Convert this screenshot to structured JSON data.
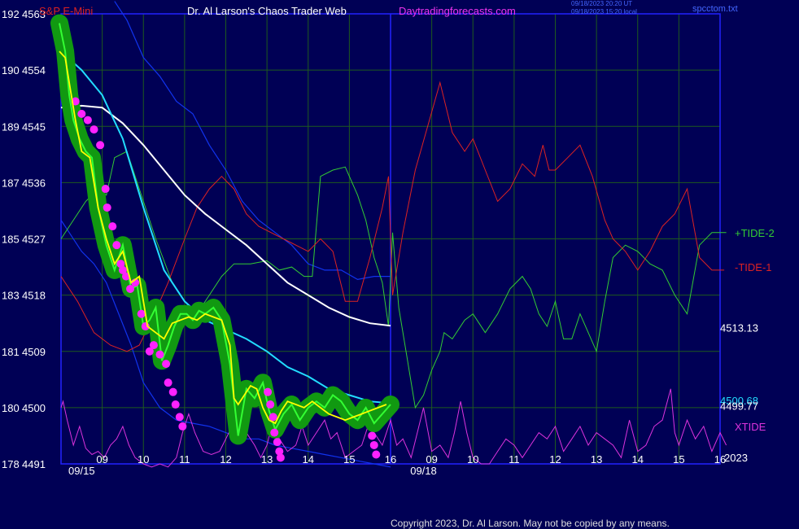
{
  "header": {
    "symbol": "S&P E-Mini",
    "title": "Dr. Al Larson's Chaos Trader Web",
    "site": "Daytradingforecasts.com",
    "timestamp_utc": "09/18/2023 20:20 UT",
    "timestamp_local": "09/18/2023 15:20 local",
    "filename": "spcctom.txt"
  },
  "footer": {
    "copyright": "Copyright 2023, Dr. Al Larson. May not be copied by any means."
  },
  "colors": {
    "background": "#000055",
    "grid": "#1e5a1e",
    "frame": "#2222ff",
    "price": "#33ff33",
    "glow": "#119911",
    "dots": "#ff22ff",
    "ma_fast": "#ffff00",
    "ma_mid": "#22ddff",
    "ma_slow": "#ffffff",
    "band": "#1133ee",
    "tide2": "#33cc33",
    "tide1": "#dd2222",
    "xtide": "#dd33dd"
  },
  "chart_data": {
    "type": "line",
    "ylim": [
      4491,
      4563
    ],
    "y_ticks": [
      {
        "left": "192",
        "right": "4563",
        "value": 4563
      },
      {
        "left": "190",
        "right": "4554",
        "value": 4554
      },
      {
        "left": "189",
        "right": "4545",
        "value": 4545
      },
      {
        "left": "187",
        "right": "4536",
        "value": 4536
      },
      {
        "left": "185",
        "right": "4527",
        "value": 4527
      },
      {
        "left": "183",
        "right": "4518",
        "value": 4518
      },
      {
        "left": "181",
        "right": "4509",
        "value": 4509
      },
      {
        "left": "180",
        "right": "4500",
        "value": 4500
      },
      {
        "left": "178",
        "right": "4491",
        "value": 4491
      }
    ],
    "x_hours": [
      {
        "label": "09",
        "t": 1
      },
      {
        "label": "10",
        "t": 2
      },
      {
        "label": "11",
        "t": 3
      },
      {
        "label": "12",
        "t": 4
      },
      {
        "label": "13",
        "t": 5
      },
      {
        "label": "14",
        "t": 6
      },
      {
        "label": "15",
        "t": 7
      },
      {
        "label": "16",
        "t": 8
      },
      {
        "label": "09",
        "t": 9
      },
      {
        "label": "10",
        "t": 10
      },
      {
        "label": "11",
        "t": 11
      },
      {
        "label": "12",
        "t": 12
      },
      {
        "label": "13",
        "t": 13
      },
      {
        "label": "14",
        "t": 14
      },
      {
        "label": "15",
        "t": 15
      },
      {
        "label": "16",
        "t": 16
      }
    ],
    "x_dates": [
      {
        "label": "09/15",
        "t": 0.5
      },
      {
        "label": "09/18",
        "t": 8.8
      }
    ],
    "year_label": "2023",
    "tide_labels": [
      {
        "name": "+TIDE-2",
        "value": 4528,
        "color_key": "tide2"
      },
      {
        "name": "-TIDE-1",
        "value": 4522.5,
        "color_key": "tide1"
      },
      {
        "name": "XTIDE",
        "value": 4497,
        "color_key": "xtide"
      }
    ],
    "price_labels": [
      {
        "text": "4513.13",
        "value": 4512.7,
        "color_key": "ma_slow"
      },
      {
        "text": "4500.68",
        "value": 4501.0,
        "color_key": "ma_mid"
      },
      {
        "text": "4499.77",
        "value": 4500.2,
        "color_key": "ma_slow"
      }
    ],
    "series": [
      {
        "key": "price",
        "x": [
          -0.04,
          0.1,
          0.2,
          0.3,
          0.45,
          0.6,
          0.75,
          0.9,
          1.1,
          1.3,
          1.5,
          1.7,
          1.85,
          2.0,
          2.15,
          2.3,
          2.45,
          2.6,
          2.75,
          2.9,
          3.05,
          3.2,
          3.35,
          3.5,
          3.7,
          3.9,
          4.1,
          4.3,
          4.5,
          4.7,
          4.9,
          5.05,
          5.2,
          5.4,
          5.6,
          5.8,
          6.0,
          6.2,
          6.4,
          6.6,
          6.8,
          7.0,
          7.2,
          7.4,
          7.6,
          7.8,
          8.0
        ],
        "y": [
          4561.5,
          4557,
          4550,
          4546,
          4543,
          4541,
          4540,
          4532,
          4526,
          4522,
          4526,
          4519,
          4519.5,
          4513,
          4514,
          4516,
          4507.5,
          4510,
          4513,
          4515,
          4515,
          4514,
          4515.5,
          4515,
          4516,
          4514,
          4507,
          4495.5,
          4503,
          4501.5,
          4504,
          4499.5,
          4496.5,
          4499,
          4500.5,
          4498,
          4500,
          4501,
          4500,
          4502,
          4501,
          4499,
          4498,
          4500,
          4497.5,
          4499,
          4500.5
        ]
      },
      {
        "key": "ma_fast",
        "x": [
          -0.04,
          0.1,
          0.2,
          0.35,
          0.5,
          0.7,
          0.9,
          1.1,
          1.3,
          1.5,
          1.7,
          1.9,
          2.1,
          2.3,
          2.5,
          2.7,
          2.9,
          3.1,
          3.3,
          3.5,
          3.7,
          3.9,
          4.1,
          4.2,
          4.3,
          4.45,
          4.6,
          4.75,
          4.9,
          5.05,
          5.2,
          5.35,
          5.5,
          5.7,
          5.9,
          6.1,
          6.3,
          6.5,
          6.7,
          6.9,
          7.1,
          7.3,
          7.5,
          7.7,
          7.9
        ],
        "y": [
          4557,
          4556,
          4552,
          4546,
          4541,
          4540,
          4532,
          4527,
          4523,
          4525,
          4520,
          4521,
          4513,
          4512,
          4511,
          4513.5,
          4514,
          4514.5,
          4514,
          4515,
          4514.5,
          4514,
          4510,
          4501.5,
          4500.5,
          4502,
          4503.5,
          4503,
          4500,
          4498,
          4497.5,
          4499.5,
          4501,
          4500.5,
          4500,
          4501,
          4500,
          4499,
          4498.5,
          4498,
          4498.5,
          4499,
          4499.5,
          4500,
          4500.5
        ]
      },
      {
        "key": "ma_mid",
        "x": [
          0,
          0.5,
          1.0,
          1.5,
          2.0,
          2.5,
          3.0,
          3.5,
          4.0,
          4.5,
          5.0,
          5.5,
          6.0,
          6.5,
          7.0,
          7.5,
          8.0
        ],
        "y": [
          4557,
          4554,
          4550,
          4543,
          4532,
          4522,
          4517,
          4514,
          4512.5,
          4511,
          4509,
          4506.5,
          4505,
          4503,
          4502,
          4501,
          4500.7
        ]
      },
      {
        "key": "ma_slow",
        "x": [
          0,
          0.5,
          1.0,
          1.5,
          2.0,
          2.5,
          3.0,
          3.5,
          4.0,
          4.5,
          5.0,
          5.5,
          6.0,
          6.5,
          7.0,
          7.5,
          8.0
        ],
        "y": [
          4548,
          4548.3,
          4548,
          4545.5,
          4542,
          4538,
          4534,
          4531,
          4528.5,
          4526,
          4523,
          4520,
          4518,
          4516,
          4514.5,
          4513.5,
          4513.1
        ]
      },
      {
        "key": "band_hi",
        "x": [
          1.3,
          1.6,
          2.0,
          2.4,
          2.8,
          3.2,
          3.6,
          4.0,
          4.4,
          4.8,
          5.2,
          5.6,
          6.0,
          6.4,
          6.8,
          7.2,
          7.6,
          8.0
        ],
        "y": [
          4565,
          4562,
          4556,
          4553,
          4549,
          4547,
          4542,
          4538,
          4533,
          4530,
          4528,
          4526,
          4523,
          4522,
          4522,
          4520.5,
          4521,
          4521
        ]
      },
      {
        "key": "band_lo",
        "x": [
          0,
          0.2,
          0.5,
          0.8,
          1.1,
          1.4,
          1.7,
          2.0,
          2.4,
          2.8,
          3.2,
          3.6,
          4.0,
          4.4,
          4.8,
          5.2,
          5.6,
          6.0,
          6.4,
          6.8,
          7.2,
          7.6,
          8.0
        ],
        "y": [
          4530,
          4528,
          4525,
          4523,
          4520,
          4515,
          4510,
          4504,
          4500,
          4498,
          4497.5,
          4497,
          4496,
          4495,
          4495,
          4494,
          4493.5,
          4493,
          4492.5,
          4492,
          4491.5,
          4491,
          4490.5
        ]
      },
      {
        "key": "tide2",
        "x": [
          0,
          0.3,
          0.6,
          0.9,
          1.1,
          1.3,
          1.6,
          1.9,
          2.3,
          2.7,
          3.0,
          3.3,
          3.6,
          3.9,
          4.2,
          4.6,
          5.0,
          5.3,
          5.6,
          5.9,
          6.1,
          6.3,
          6.6,
          6.9,
          7.2,
          7.4,
          7.6,
          7.8,
          7.95,
          8.05,
          8.2,
          8.4,
          8.6,
          8.8,
          9.0,
          9.2,
          9.3,
          9.5,
          9.8,
          10.0,
          10.3,
          10.6,
          10.9,
          11.2,
          11.4,
          11.6,
          11.8,
          12.0,
          12.2,
          12.4,
          12.6,
          12.8,
          13.0,
          13.2,
          13.4,
          13.7,
          14.0,
          14.3,
          14.6,
          14.9,
          15.2,
          15.5,
          15.8,
          16.1,
          16.15
        ],
        "y": [
          4527,
          4530,
          4533,
          4535,
          4534,
          4540,
          4541,
          4535,
          4527,
          4520,
          4517,
          4515,
          4518,
          4521,
          4523,
          4523,
          4523.5,
          4522,
          4522.5,
          4521,
          4521,
          4537,
          4538,
          4538.5,
          4534,
          4530,
          4524,
          4520,
          4513,
          4528,
          4516,
          4508,
          4500,
          4502,
          4506,
          4509,
          4512,
          4511,
          4514,
          4515,
          4512,
          4515,
          4519,
          4521,
          4519,
          4515,
          4513,
          4517,
          4511,
          4511,
          4515,
          4512,
          4509,
          4517,
          4524,
          4526,
          4525,
          4523,
          4522,
          4518,
          4515,
          4526,
          4528,
          4528,
          4528
        ]
      },
      {
        "key": "tide1",
        "x": [
          0,
          0.4,
          0.8,
          1.2,
          1.6,
          1.9,
          2.2,
          2.6,
          3.0,
          3.3,
          3.6,
          3.9,
          4.2,
          4.5,
          4.8,
          5.1,
          5.4,
          5.7,
          6.0,
          6.3,
          6.6,
          6.9,
          7.2,
          7.5,
          7.8,
          7.95,
          8.05,
          8.3,
          8.6,
          8.9,
          9.2,
          9.5,
          9.8,
          10.0,
          10.3,
          10.6,
          10.9,
          11.2,
          11.5,
          11.7,
          11.85,
          12.0,
          12.3,
          12.6,
          12.9,
          13.2,
          13.4,
          13.7,
          14.0,
          14.3,
          14.6,
          14.9,
          15.2,
          15.5,
          15.8,
          16.1
        ],
        "y": [
          4521,
          4517,
          4512,
          4510,
          4509,
          4510,
          4514,
          4520,
          4527,
          4532,
          4535,
          4537,
          4535,
          4531,
          4529,
          4528,
          4527,
          4526,
          4525,
          4527,
          4525,
          4517,
          4517,
          4524,
          4532,
          4537,
          4518,
          4528,
          4538,
          4545,
          4552,
          4544,
          4541,
          4543,
          4538,
          4533,
          4535,
          4539,
          4537,
          4542,
          4538,
          4538,
          4540,
          4542,
          4537,
          4530,
          4527,
          4525,
          4522,
          4525,
          4529,
          4531,
          4535,
          4524,
          4522,
          4522
        ]
      },
      {
        "key": "xtide",
        "x": [
          0,
          0.05,
          0.15,
          0.3,
          0.45,
          0.6,
          0.75,
          0.9,
          1.05,
          1.2,
          1.35,
          1.5,
          1.65,
          1.8,
          2.0,
          2.2,
          2.4,
          2.6,
          2.8,
          2.95,
          3.1,
          3.25,
          3.45,
          3.65,
          3.85,
          4.0,
          4.15,
          4.3,
          4.5,
          4.7,
          4.85,
          5.0,
          5.15,
          5.3,
          5.5,
          5.7,
          5.85,
          6.0,
          6.2,
          6.4,
          6.55,
          6.7,
          6.9,
          7.1,
          7.3,
          7.45,
          7.6,
          7.8,
          8.0,
          8.15,
          8.3,
          8.5,
          8.65,
          8.8,
          9.0,
          9.2,
          9.4,
          9.55,
          9.7,
          9.85,
          10.0,
          10.2,
          10.4,
          10.6,
          10.8,
          11.0,
          11.2,
          11.4,
          11.6,
          11.8,
          12.0,
          12.2,
          12.4,
          12.6,
          12.8,
          13.0,
          13.2,
          13.4,
          13.6,
          13.8,
          14.0,
          14.2,
          14.4,
          14.6,
          14.8,
          14.9,
          15.0,
          15.2,
          15.4,
          15.6,
          15.8,
          16.0,
          16.15
        ],
        "y": [
          4500,
          4501,
          4498,
          4494,
          4497,
          4493.5,
          4492.5,
          4493,
          4492,
          4494,
          4495,
          4497,
          4494,
          4492,
          4491,
          4490.5,
          4491,
          4490.5,
          4492,
          4496,
          4499,
          4496,
          4493,
          4492.5,
          4493,
          4495,
          4497,
          4495,
          4496,
          4494,
          4492,
          4494,
          4498,
          4495,
          4493,
          4494,
          4497,
          4494,
          4496,
          4498,
          4495,
          4496,
          4492,
          4493,
          4494,
          4497,
          4496,
          4494,
          4498,
          4494,
          4495,
          4492,
          4496,
          4500,
          4493,
          4494,
          4492,
          4496,
          4501,
          4496,
          4492,
          4491,
          4491,
          4493,
          4495,
          4494,
          4492,
          4494,
          4496,
          4495,
          4497,
          4493,
          4495,
          4497,
          4494,
          4496,
          4495,
          4494,
          4492,
          4498,
          4493,
          4494,
          4497,
          4498,
          4503,
          4496,
          4494,
          4498,
          4495,
          4497,
          4493,
          4496,
          4494
        ]
      }
    ],
    "dots": {
      "x": [
        0.35,
        0.5,
        0.65,
        0.8,
        0.95,
        1.08,
        1.12,
        1.25,
        1.35,
        1.45,
        1.5,
        1.58,
        1.68,
        1.8,
        1.95,
        2.05,
        2.15,
        2.25,
        2.4,
        2.55,
        2.6,
        2.72,
        2.78,
        2.88,
        2.95,
        5.02,
        5.08,
        5.15,
        5.18,
        5.25,
        5.3,
        5.33,
        7.55,
        7.6,
        7.65
      ],
      "y": [
        4549,
        4547,
        4546,
        4544.5,
        4542,
        4535,
        4532,
        4529,
        4526,
        4523,
        4522,
        4521,
        4519,
        4520,
        4515,
        4513,
        4509,
        4510,
        4508.5,
        4507,
        4504,
        4502.5,
        4500.5,
        4498.5,
        4497,
        4502.5,
        4500.5,
        4498.5,
        4496,
        4494.5,
        4493,
        4492,
        4495.5,
        4494,
        4492.5
      ]
    }
  }
}
